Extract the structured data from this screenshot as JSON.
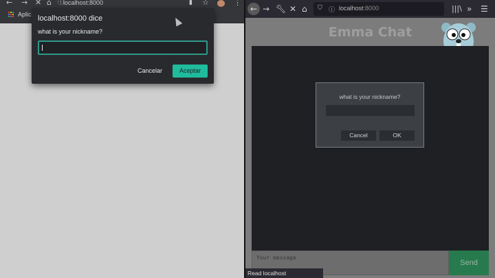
{
  "chrome": {
    "url": "localhost:8000",
    "bookmark_label": "Aplica",
    "icons": [
      "back-arrow-icon",
      "forward-arrow-icon",
      "close-icon",
      "home-icon",
      "info-icon",
      "star-icon"
    ],
    "dialog": {
      "title": "localhost:8000 dice",
      "message": "what is your nickname?",
      "input_value": "",
      "cancel_label": "Cancelar",
      "accept_label": "Aceptar",
      "accent_color": "#1ebc9c"
    }
  },
  "firefox": {
    "url_host": "localhost",
    "url_port": ":8000",
    "icons": [
      "back-arrow-icon",
      "forward-arrow-icon",
      "wrench-icon",
      "close-icon",
      "home-icon",
      "shield-icon",
      "info-icon",
      "library-icon",
      "overflow-icon",
      "menu-icon"
    ],
    "page": {
      "title": "Emma Chat",
      "dialog": {
        "message": "what is your nickname?",
        "input_value": "",
        "cancel_label": "Cancel",
        "ok_label": "OK"
      },
      "message_placeholder": "Your message",
      "send_label": "Send",
      "send_color": "#277a4d"
    },
    "status_text": "Read localhost"
  }
}
